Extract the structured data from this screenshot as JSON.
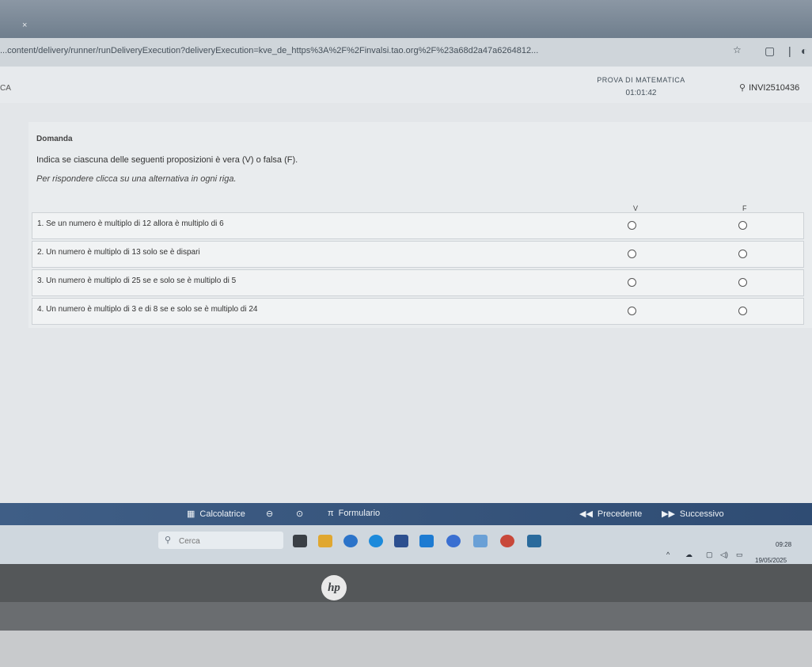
{
  "browser": {
    "url": "...content/delivery/runner/runDeliveryExecution?deliveryExecution=kve_de_https%3A%2F%2Finvalsi.tao.org%2F%23a68d2a47a6264812...",
    "tab_close_glyph": "×",
    "star_glyph": "☆"
  },
  "header": {
    "brand_fragment": "CA",
    "test_title": "PROVA DI MATEMATICA",
    "timer": "01:01:42",
    "user_code": "INVI2510436"
  },
  "question": {
    "label": "Domanda",
    "prompt": "Indica se ciascuna delle seguenti proposizioni è vera (V) o falsa (F).",
    "hint": "Per rispondere clicca su una alternativa in ogni riga.",
    "columns": {
      "true": "V",
      "false": "F"
    },
    "rows": [
      {
        "text": "1. Se un numero è multiplo di 12 allora è multiplo di 6"
      },
      {
        "text": "2. Un numero è multiplo di 13 solo se è dispari"
      },
      {
        "text": "3. Un numero è multiplo di 25 se e solo se è multiplo di 5"
      },
      {
        "text": "4. Un numero è multiplo di 3 e di 8 se e solo se è multiplo di 24"
      }
    ]
  },
  "toolbar": {
    "calculator": "Calcolatrice",
    "formulas": "Formulario",
    "formulas_icon": "π",
    "previous": "Precedente",
    "next": "Successivo"
  },
  "taskbar": {
    "search_placeholder": "Cerca",
    "time": "09:28",
    "date": "19/05/2025",
    "app_colors": [
      "#3a3f45",
      "#e0a730",
      "#2b73c9",
      "#1c8adb",
      "#2c4f8f",
      "#1d7bd2",
      "#3a6fd1",
      "#6aa0d6",
      "#c8483a",
      "#2a6a9c"
    ]
  },
  "laptop": {
    "logo": "hp"
  }
}
